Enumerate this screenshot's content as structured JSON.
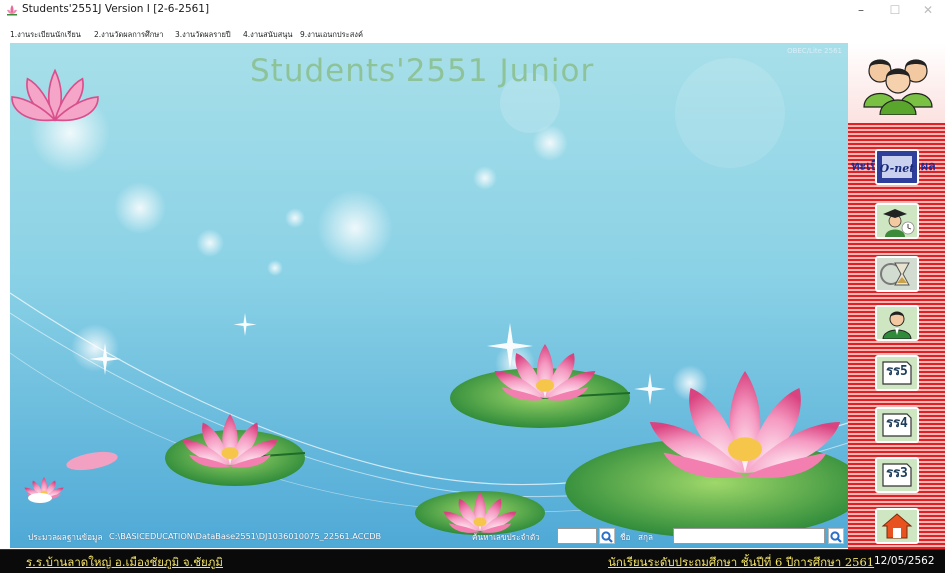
{
  "window": {
    "title": "Students'2551J Version I [2-6-2561]",
    "minimize_glyph": "–",
    "maximize_glyph": "☐",
    "close_glyph": "✕"
  },
  "menu": [
    {
      "label": "1.งานระเบียนนักเรียน"
    },
    {
      "label": "2.งานวัดผลการศึกษา"
    },
    {
      "label": "3.งานวัดผลรายปี"
    },
    {
      "label": "4.งานสนับสนุน"
    },
    {
      "label": "9.งานเอนกประสงค์"
    }
  ],
  "main": {
    "heading": "Students'2551 Junior",
    "version_ghost": "OBEC/Lite 2561"
  },
  "status": {
    "db_label": "ประมวลผลฐานข้อมูล",
    "db_path": "C:\\BASICEDUCATION\\DataBase2551\\DJ1036010075_22561.ACCDB",
    "id_label": "ค้นหาเลขประจำตัว",
    "id_value": "",
    "name_label": "ชื่อ",
    "surname_label": "สกุล",
    "name_value": ""
  },
  "sidebar": {
    "heading": "ทะเบียน&วัดผล",
    "buttons": [
      {
        "name": "onet-button",
        "icon": "onet-icon",
        "label": "O-net"
      },
      {
        "name": "graduate-button",
        "icon": "graduate-icon"
      },
      {
        "name": "hourglass-button",
        "icon": "hourglass-icon"
      },
      {
        "name": "teacher-button",
        "icon": "teacher-icon"
      },
      {
        "name": "ror5-button",
        "icon": "document-icon",
        "label": "รร5"
      },
      {
        "name": "ror4-button",
        "icon": "document-icon",
        "label": "รร4"
      },
      {
        "name": "ror3-button",
        "icon": "document-icon",
        "label": "รร3"
      },
      {
        "name": "home-button",
        "icon": "home-icon"
      }
    ]
  },
  "footer": {
    "school": "ร.ร.บ้านลาดใหญ่  อ.เมืองชัยภูมิ  จ.ชัยภูมิ",
    "level": "นักเรียนระดับประถมศึกษา  ชั้นปีที่ 6  ปีการศึกษา 2561",
    "date": "12/05/2562"
  },
  "colors": {
    "sidebar_stripe_red": "#e21f25",
    "sidebar_stripe_pink": "#f7b8b4",
    "heading_green": "#8ec39a",
    "footer_text": "#f3e36a",
    "sidebar_heading": "#1b2b9a"
  }
}
